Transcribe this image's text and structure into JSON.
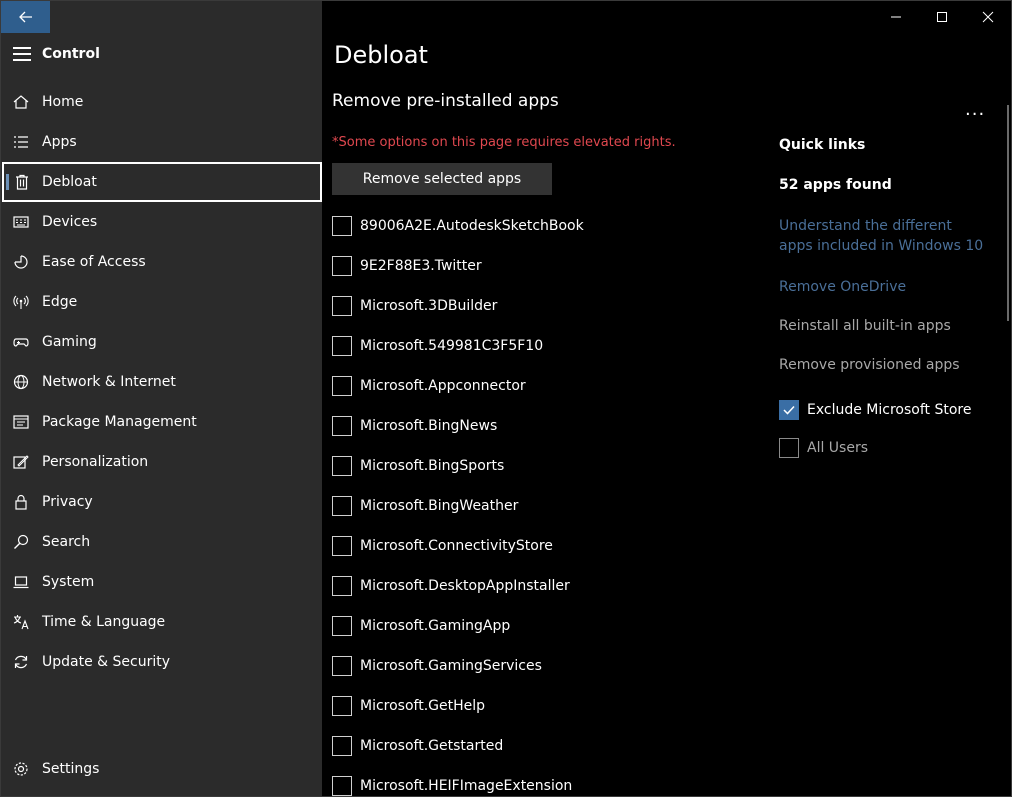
{
  "sidebar": {
    "app_title": "Control",
    "items": [
      {
        "label": "Home",
        "icon": "home-icon"
      },
      {
        "label": "Apps",
        "icon": "apps-icon"
      },
      {
        "label": "Debloat",
        "icon": "trash-icon",
        "selected": true
      },
      {
        "label": "Devices",
        "icon": "keyboard-icon"
      },
      {
        "label": "Ease of Access",
        "icon": "ease-of-access-icon"
      },
      {
        "label": "Edge",
        "icon": "antenna-icon"
      },
      {
        "label": "Gaming",
        "icon": "gamepad-icon"
      },
      {
        "label": "Network & Internet",
        "icon": "globe-icon"
      },
      {
        "label": "Package Management",
        "icon": "package-icon"
      },
      {
        "label": "Personalization",
        "icon": "brush-icon"
      },
      {
        "label": "Privacy",
        "icon": "lock-icon"
      },
      {
        "label": "Search",
        "icon": "search-icon"
      },
      {
        "label": "System",
        "icon": "laptop-icon"
      },
      {
        "label": "Time & Language",
        "icon": "language-icon"
      },
      {
        "label": "Update & Security",
        "icon": "sync-icon"
      }
    ],
    "settings_label": "Settings"
  },
  "main": {
    "page_title": "Debloat",
    "section_title": "Remove pre-installed apps",
    "warning": "*Some options on this page requires elevated rights.",
    "remove_button": "Remove selected apps",
    "apps": [
      "89006A2E.AutodeskSketchBook",
      "9E2F88E3.Twitter",
      "Microsoft.3DBuilder",
      "Microsoft.549981C3F5F10",
      "Microsoft.Appconnector",
      "Microsoft.BingNews",
      "Microsoft.BingSports",
      "Microsoft.BingWeather",
      "Microsoft.ConnectivityStore",
      "Microsoft.DesktopAppInstaller",
      "Microsoft.GamingApp",
      "Microsoft.GamingServices",
      "Microsoft.GetHelp",
      "Microsoft.Getstarted",
      "Microsoft.HEIFImageExtension"
    ]
  },
  "right_panel": {
    "more": "...",
    "quick_links_title": "Quick links",
    "apps_found": "52 apps found",
    "link_understand": "Understand the different apps included in Windows 10",
    "link_remove_onedrive": "Remove OneDrive",
    "reinstall": "Reinstall all built-in apps",
    "remove_provisioned": "Remove provisioned apps",
    "exclude_store_label": "Exclude Microsoft Store",
    "exclude_store_checked": true,
    "all_users_label": "All Users",
    "all_users_checked": false
  },
  "colors": {
    "accent": "#2f5e8d",
    "warning": "#e0484f",
    "link": "#4a6f98",
    "sidebar_bg": "#2b2b2b"
  }
}
